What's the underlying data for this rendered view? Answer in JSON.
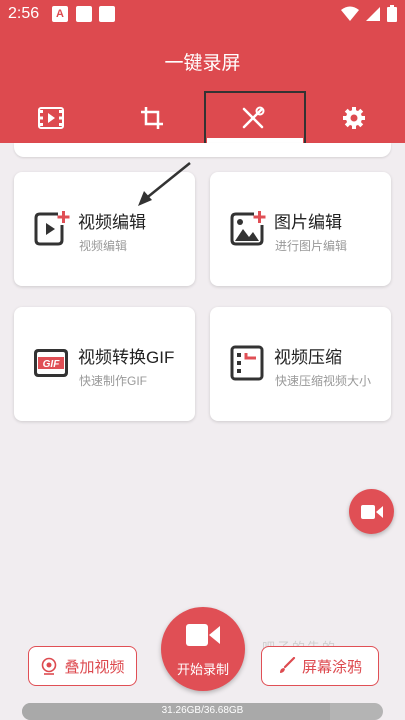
{
  "status_bar": {
    "time": "2:56",
    "notif_letter": "A"
  },
  "app": {
    "title": "一键录屏"
  },
  "tabs": [
    {
      "icon": "film-icon"
    },
    {
      "icon": "crop-icon"
    },
    {
      "icon": "tools-icon",
      "selected": true
    },
    {
      "icon": "gear-icon"
    }
  ],
  "cards": [
    {
      "title": "视频编辑",
      "subtitle": "视频编辑",
      "icon": "video-edit-icon"
    },
    {
      "title": "图片编辑",
      "subtitle": "进行图片编辑",
      "icon": "image-edit-icon"
    },
    {
      "title": "视频转换GIF",
      "subtitle": "快速制作GIF",
      "icon": "gif-icon"
    },
    {
      "title": "视频压缩",
      "subtitle": "快速压缩视频大小",
      "icon": "video-compress-icon"
    }
  ],
  "bottom": {
    "record_label": "开始录制",
    "overlay_label": "叠加视频",
    "doodle_label": "屏幕涂鸦",
    "watermark": "吧子的告的"
  },
  "storage": {
    "text": "31.26GB/36.68GB",
    "used_fraction": 0.852
  },
  "colors": {
    "primary": "#dd4a4f",
    "background": "#f1edf0"
  }
}
